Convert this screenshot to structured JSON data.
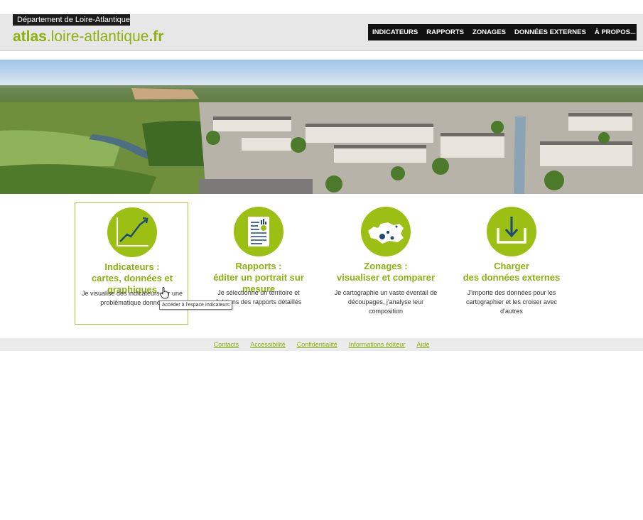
{
  "header": {
    "dept_label": "Département de Loire-Atlantique",
    "logo": {
      "part1": "atlas",
      "part2": ".loire-atlantique",
      "part3": ".fr"
    }
  },
  "nav": {
    "items": [
      {
        "label": "INDICATEURS"
      },
      {
        "label": "RAPPORTS"
      },
      {
        "label": "ZONAGES"
      },
      {
        "label": "DONNÉES EXTERNES"
      },
      {
        "label": "À PROPOS..."
      }
    ],
    "user_icon": "user-icon"
  },
  "cards": [
    {
      "icon": "line-chart-icon",
      "title": "Indicateurs :\ncartes, données et\ngraphiques",
      "desc": "Je visualise des indicateurs sur une\nproblématique donnée"
    },
    {
      "icon": "report-document-icon",
      "title": "Rapports :\néditer un portrait sur\nmesure",
      "desc": "Je sélectionne un territoire et\nj'obtiens des rapports détaillés"
    },
    {
      "icon": "map-zones-icon",
      "title": "Zonages :\nvisualiser et comparer",
      "desc": "Je cartographie un vaste éventail de\ndécoupages, j'analyse leur\ncomposition"
    },
    {
      "icon": "download-tray-icon",
      "title": "Charger\ndes données externes",
      "desc": "J'importe des données pour les\ncartographier et les croiser avec\nd'autres"
    }
  ],
  "tooltip": "Accéder à l'espace Indicateurs",
  "footer": {
    "links": [
      "Contacts",
      "Accessibilité",
      "Confidentialité",
      "Informations éditeur",
      "Aide"
    ]
  },
  "colors": {
    "accent": "#9bbf12",
    "nav_bg": "#111111",
    "footer_bg": "#ebebeb"
  }
}
